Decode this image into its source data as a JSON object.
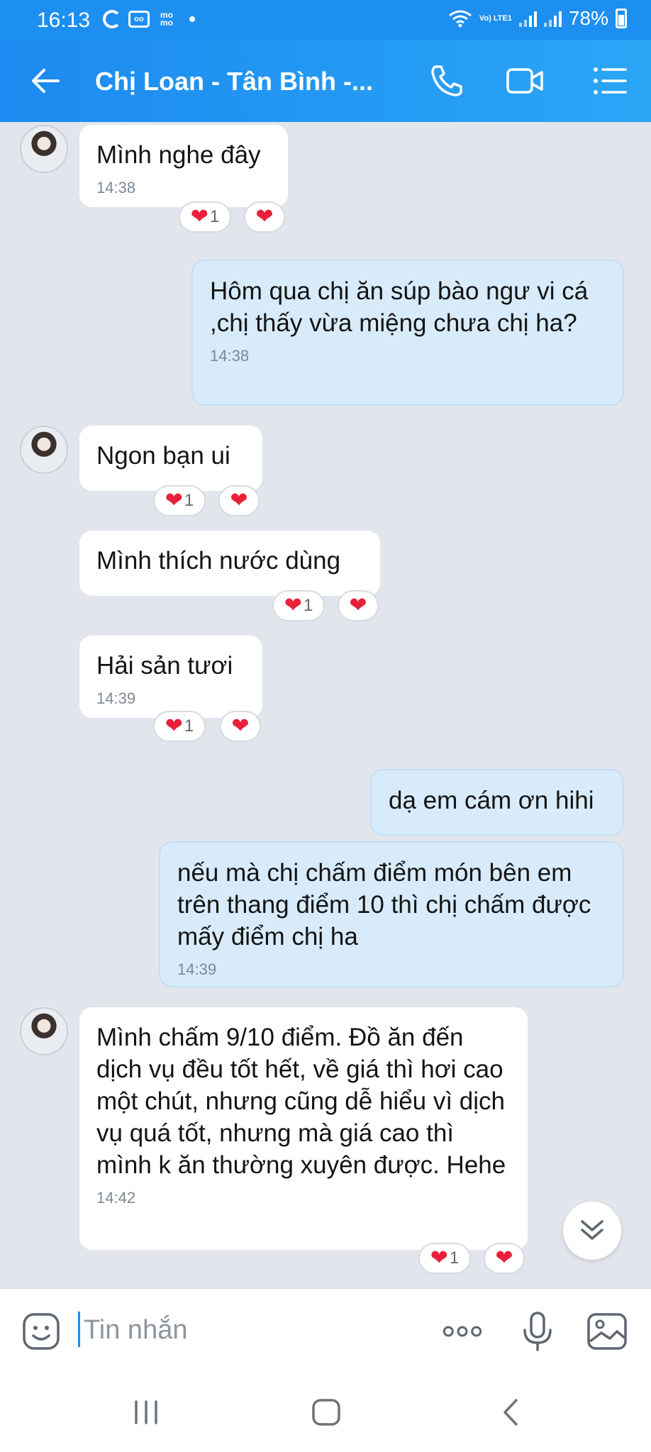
{
  "status_bar": {
    "time": "16:13",
    "momo": "mo mo",
    "volte": "Vo) LTE1",
    "battery": "78%"
  },
  "header": {
    "title": "Chị Loan - Tân Bình -..."
  },
  "messages": [
    {
      "text": "Mình nghe đây",
      "time": "14:38",
      "react_count": "1"
    },
    {
      "text": "Hôm qua chị ăn súp bào ngư vi cá ,chị  thấy vừa miệng chưa chị ha?",
      "time": "14:38"
    },
    {
      "text": "Ngon bạn ui",
      "react_count": "1"
    },
    {
      "text": "Mình thích nước dùng",
      "react_count": "1"
    },
    {
      "text": "Hải sản tươi",
      "time": "14:39",
      "react_count": "1"
    },
    {
      "text": "dạ em cám ơn hihi"
    },
    {
      "text": "nếu mà chị chấm điểm món bên em trên thang điểm 10 thì chị chấm được mấy điểm chị ha",
      "time": "14:39"
    },
    {
      "text": "Mình chấm 9/10 điểm. Đồ ăn đến dịch vụ đều tốt hết, về giá thì hơi cao một chút, nhưng cũng dễ hiểu vì dịch vụ quá tốt, nhưng mà giá cao thì mình k ăn thường xuyên được. Hehe",
      "time": "14:42",
      "react_count": "1"
    }
  ],
  "input": {
    "placeholder": "Tin nhắn"
  },
  "icons": {
    "back": "back-arrow-icon",
    "call": "phone-icon",
    "video": "video-camera-icon",
    "menu": "list-menu-icon",
    "emoji": "emoji-icon",
    "more": "more-dots-icon",
    "mic": "microphone-icon",
    "image": "image-icon",
    "scroll": "chevron-double-down-icon",
    "heart": "heart-icon"
  },
  "colors": {
    "header": "#1d8ff0",
    "incoming": "#ffffff",
    "outgoing": "#d7ebfb",
    "heart": "#e8203a"
  }
}
